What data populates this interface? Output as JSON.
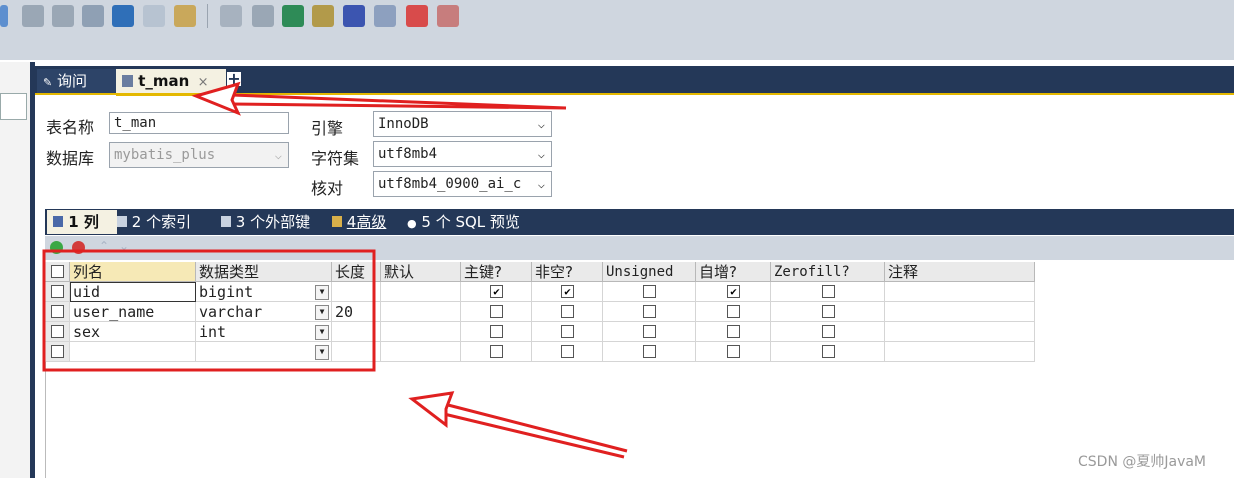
{
  "toolbar": {
    "icons": [
      "database-add-icon",
      "database-add-icon",
      "database-remove-icon",
      "database-refresh-icon",
      "table-icon",
      "table-icon",
      "table-icon",
      "tools-icon",
      "database-icon",
      "database-icon",
      "truck-icon",
      "schema-icon",
      "window-icon",
      "grid-icon",
      "hierarchy-icon"
    ]
  },
  "tabs": {
    "query": "询问",
    "current": "t_man",
    "close": "×",
    "add": "+"
  },
  "form": {
    "table_name_label": "表名称",
    "table_name_value": "t_man",
    "database_label": "数据库",
    "database_value": "mybatis_plus",
    "engine_label": "引擎",
    "engine_value": "InnoDB",
    "charset_label": "字符集",
    "charset_value": "utf8mb4",
    "collation_label": "核对",
    "collation_value": "utf8mb4_0900_ai_c"
  },
  "subtabs": {
    "columns": "1 列",
    "indexes": "2 个索引",
    "foreign_keys": "3 个外部键",
    "advanced": "4高级",
    "sql_preview": "5 个 SQL 预览"
  },
  "grid": {
    "headers": {
      "name": "列名",
      "type": "数据类型",
      "length": "长度",
      "default": "默认",
      "primary_key": "主键?",
      "not_null": "非空?",
      "unsigned": "Unsigned",
      "auto_increment": "自增?",
      "zerofill": "Zerofill?",
      "comment": "注释"
    },
    "rows": [
      {
        "name": "uid",
        "type": "bigint",
        "length": "",
        "default": "",
        "pk": true,
        "nn": true,
        "unsigned": false,
        "ai": true,
        "zf": false,
        "comment": ""
      },
      {
        "name": "user_name",
        "type": "varchar",
        "length": "20",
        "default": "",
        "pk": false,
        "nn": false,
        "unsigned": false,
        "ai": false,
        "zf": false,
        "comment": ""
      },
      {
        "name": "sex",
        "type": "int",
        "length": "",
        "default": "",
        "pk": false,
        "nn": false,
        "unsigned": false,
        "ai": false,
        "zf": false,
        "comment": ""
      },
      {
        "name": "",
        "type": "",
        "length": "",
        "default": "",
        "pk": false,
        "nn": false,
        "unsigned": false,
        "ai": false,
        "zf": false,
        "comment": ""
      }
    ]
  },
  "watermark": "CSDN @夏帅JavaM",
  "colors": {
    "toolbar_bg": "#cfd6df",
    "tab_bar": "#243858",
    "active_tab": "#f4f1e2",
    "accent_yellow": "#e4b800",
    "annotation_red": "#e02020"
  }
}
